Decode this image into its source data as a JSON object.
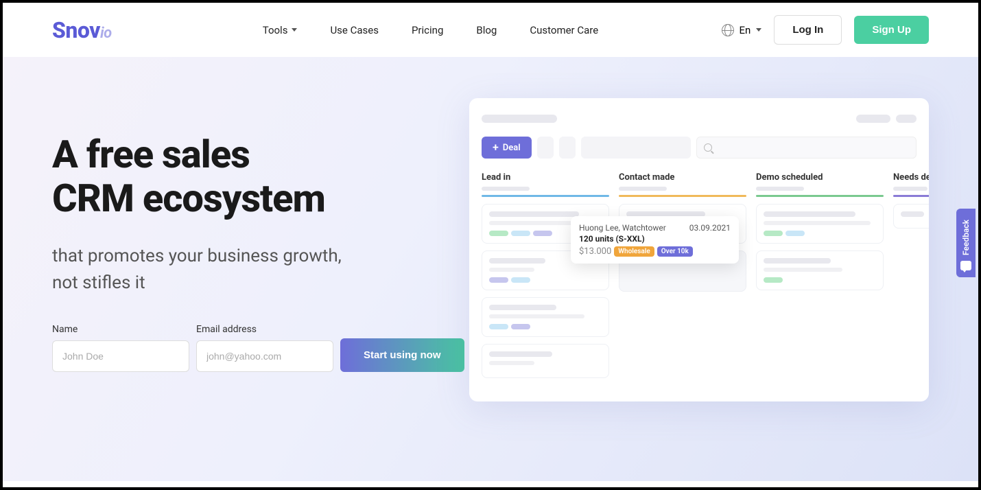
{
  "logo": {
    "main": "Snov",
    "suffix": "io"
  },
  "nav": {
    "tools": "Tools",
    "use_cases": "Use Cases",
    "pricing": "Pricing",
    "blog": "Blog",
    "customer_care": "Customer Care"
  },
  "lang": "En",
  "auth": {
    "login": "Log In",
    "signup": "Sign Up"
  },
  "hero": {
    "title_line1": "A free sales",
    "title_line2": "CRM ecosystem",
    "sub_line1": "that promotes your business growth,",
    "sub_line2": "not stifles it"
  },
  "form": {
    "name_label": "Name",
    "name_placeholder": "John Doe",
    "email_label": "Email address",
    "email_placeholder": "john@yahoo.com",
    "cta": "Start using now"
  },
  "mockup": {
    "deal_button": "Deal",
    "columns": {
      "lead": "Lead in",
      "contact": "Contact made",
      "demo": "Demo scheduled",
      "needs": "Needs de"
    },
    "popup": {
      "contact": "Huong Lee, Watchtower",
      "date": "03.09.2021",
      "title": "120 units (S-XXL)",
      "price": "$13.000",
      "badge1": "Wholesale",
      "badge2": "Over 10k"
    }
  },
  "feedback": "Feedback"
}
